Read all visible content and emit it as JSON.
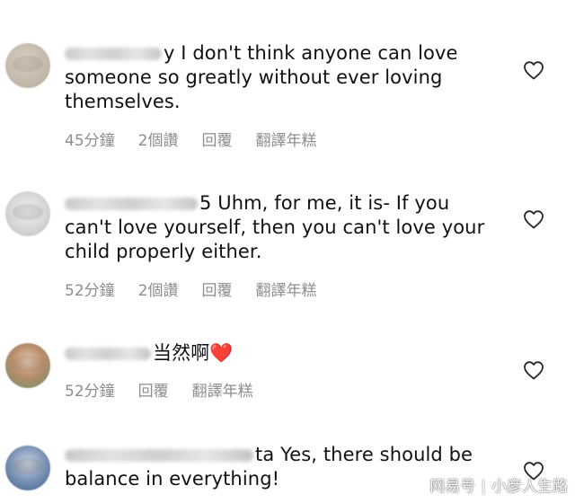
{
  "comments": [
    {
      "name_tail": "y",
      "text_first": " I don't think anyone can love",
      "text_rest": "someone so greatly without ever loving themselves.",
      "time": "45分鐘",
      "likes": "2個讚",
      "reply": "回覆",
      "translate": "翻譯年糕"
    },
    {
      "name_tail": "5",
      "text_first": " Uhm, for me, it is-  If you",
      "text_rest": "can't love yourself, then you can't love your child properly either.",
      "time": "52分鐘",
      "likes": "2個讚",
      "reply": "回覆",
      "translate": "翻譯年糕"
    },
    {
      "name_tail": "",
      "text_first": "当然啊",
      "emoji": "❤️",
      "time": "52分鐘",
      "reply": "回覆",
      "translate": "翻譯年糕"
    },
    {
      "name_tail": "ta",
      "text_first": " Yes, there should be",
      "text_rest": "balance in everything!"
    }
  ],
  "icons": {
    "like": "heart-outline-icon"
  },
  "watermark": {
    "left": "网易号",
    "right": "小彦人生路"
  }
}
